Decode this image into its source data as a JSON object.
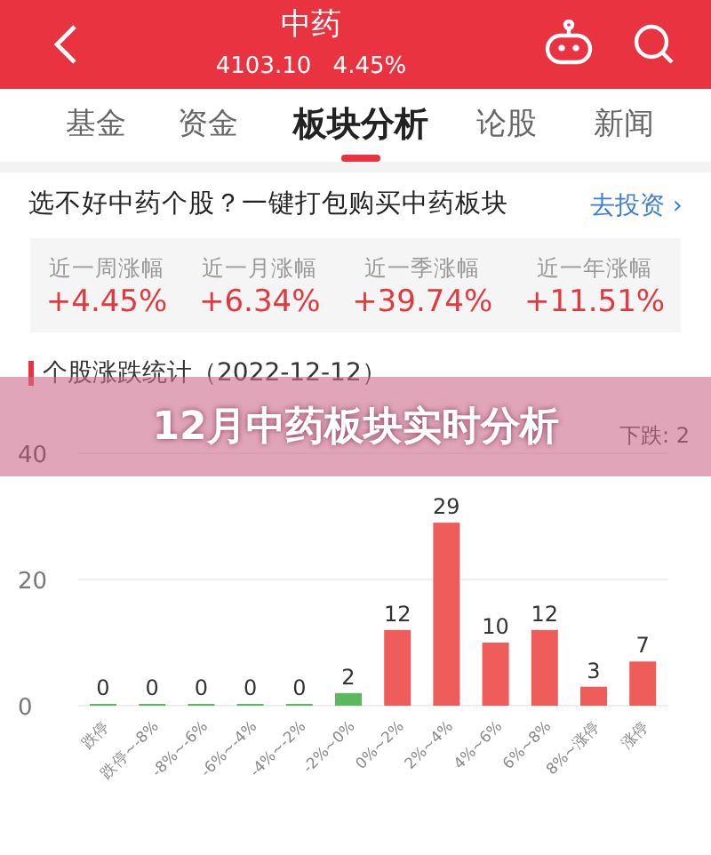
{
  "header": {
    "title": "中药",
    "price": "4103.10",
    "change": "4.45%"
  },
  "tabs": [
    {
      "label": "基金",
      "selected": false
    },
    {
      "label": "资金",
      "selected": false
    },
    {
      "label": "板块分析",
      "selected": true
    },
    {
      "label": "论股",
      "selected": false
    },
    {
      "label": "新闻",
      "selected": false
    }
  ],
  "promo": {
    "text": "选不好中药个股？一键打包购买中药板块",
    "link": "去投资 ›"
  },
  "stats": [
    {
      "label": "近一周涨幅",
      "value": "+4.45%"
    },
    {
      "label": "近一月涨幅",
      "value": "+6.34%"
    },
    {
      "label": "近一季涨幅",
      "value": "+39.74%"
    },
    {
      "label": "近一年涨幅",
      "value": "+11.51%"
    }
  ],
  "chart": {
    "legend": "下跌: 2",
    "chart_data": {
      "type": "bar",
      "title": "个股涨跌统计（2022-12-12）",
      "categories": [
        "跌停",
        "跌停~-8%",
        "-8%~-6%",
        "-6%~-4%",
        "-4%~-2%",
        "-2%~0%",
        "0%~2%",
        "2%~4%",
        "4%~6%",
        "6%~8%",
        "8%~涨停",
        "涨停"
      ],
      "series": [
        {
          "color": "#5cb85c",
          "values": [
            0,
            0,
            0,
            0,
            0,
            2,
            null,
            null,
            null,
            null,
            null,
            null
          ]
        },
        {
          "color": "#ef5d5a",
          "values": [
            null,
            null,
            null,
            null,
            null,
            null,
            12,
            29,
            10,
            12,
            3,
            7
          ]
        }
      ],
      "ylim": [
        0,
        40
      ],
      "yticks": [
        0,
        20,
        40
      ],
      "stacked": true,
      "data_labels": true
    }
  },
  "overlay_title": "12月中药板块实时分析"
}
